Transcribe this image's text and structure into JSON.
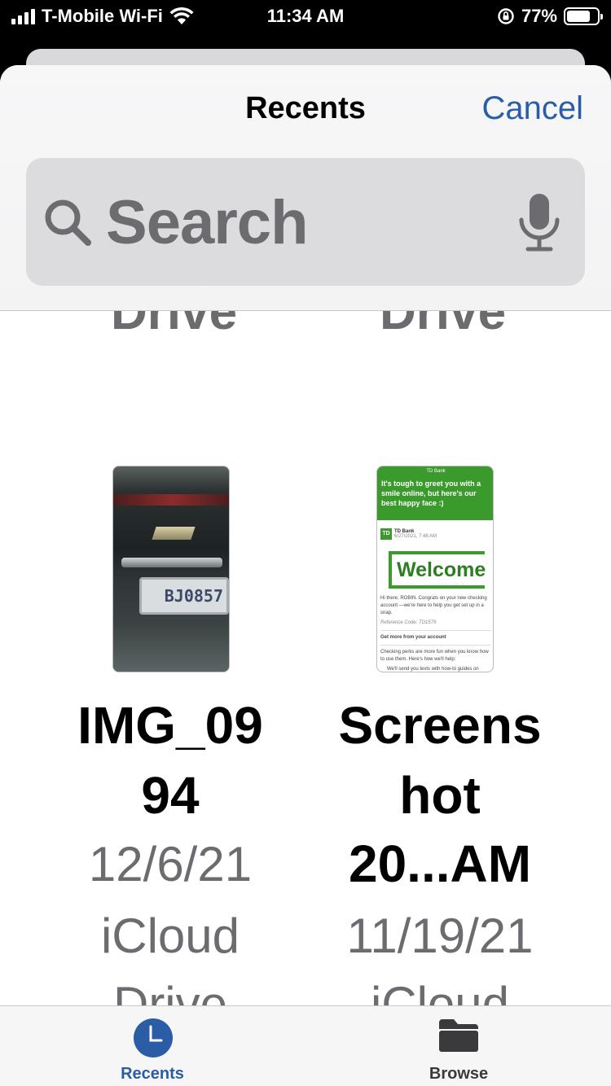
{
  "status_bar": {
    "carrier": "T-Mobile Wi-Fi",
    "time": "11:34 AM",
    "battery_percent": "77%",
    "battery_level": 0.77
  },
  "header": {
    "title": "Recents",
    "cancel_label": "Cancel"
  },
  "search": {
    "placeholder": "Search"
  },
  "partial_labels": {
    "left": "Drive",
    "right": "Drive"
  },
  "files": [
    {
      "name_line1": "IMG_09",
      "name_line2": "94",
      "date": "12/6/21",
      "location_line1": "iCloud",
      "location_line2": "Drive",
      "thumb_plate": "BJ0857"
    },
    {
      "name_line1": "Screens",
      "name_line2": "hot",
      "name_line3": "20...AM",
      "date": "11/19/21",
      "location_line1": "iCloud",
      "thumb": {
        "bar": "TD Bank",
        "headline": "It's tough to greet you with a smile online, but here's our best happy face :)",
        "logo": "TD",
        "sender": "TD Bank",
        "sender_date": "6/27/2021, 7:48 AM",
        "welcome": "Welcome",
        "greeting": "Hi there, ROBIN. Congrats on your new checking account —we're here to help you get set up in a snap.",
        "reference": "Reference Code: TD1579",
        "section": "Get more from your account",
        "section_body": "Checking perks are more fun when you know how to use them. Here's how we'll help:",
        "bullet": "We'll send you texts with how-to guides on everything from making your first deposit to getting familiar with"
      }
    }
  ],
  "tabs": [
    {
      "label": "Recents",
      "active": true,
      "color": "#2b5da6"
    },
    {
      "label": "Browse",
      "active": false,
      "color": "#3a3a3c"
    }
  ],
  "colors": {
    "accent": "#2b5da6",
    "td_green": "#3a9a2c"
  }
}
